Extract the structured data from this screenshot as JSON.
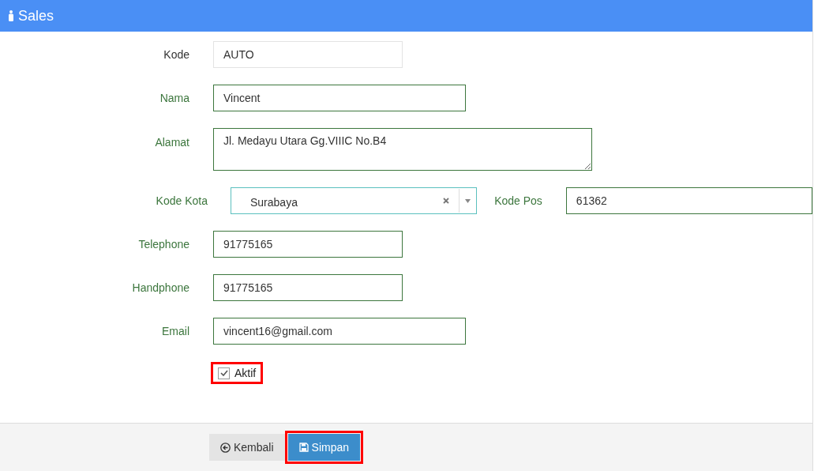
{
  "header": {
    "title": "Sales"
  },
  "fields": [
    {
      "label": "Kode",
      "value": "AUTO",
      "kind": "text",
      "readonly": true
    },
    {
      "label": "Nama",
      "value": "Vincent",
      "kind": "text",
      "readonly": false
    },
    {
      "label": "Alamat",
      "value": "Jl. Medayu Utara Gg.VIIIC No.B4",
      "kind": "textarea",
      "readonly": false
    },
    {
      "label": "Kode Kota",
      "value": "Surabaya",
      "kind": "select",
      "readonly": false,
      "extra_label": "Kode Pos",
      "extra_value": "61362"
    },
    {
      "label": "Telephone",
      "value": "91775165",
      "kind": "text",
      "readonly": false
    },
    {
      "label": "Handphone",
      "value": "91775165",
      "kind": "text",
      "readonly": false
    },
    {
      "label": "Email",
      "value": "vincent16@gmail.com",
      "kind": "text",
      "readonly": false
    }
  ],
  "aktif": {
    "label": "Aktif",
    "checked": true,
    "highlighted": true
  },
  "buttons": [
    {
      "label": "Kembali",
      "kind": "back",
      "highlighted": false
    },
    {
      "label": "Simpan",
      "kind": "save",
      "highlighted": true
    }
  ]
}
